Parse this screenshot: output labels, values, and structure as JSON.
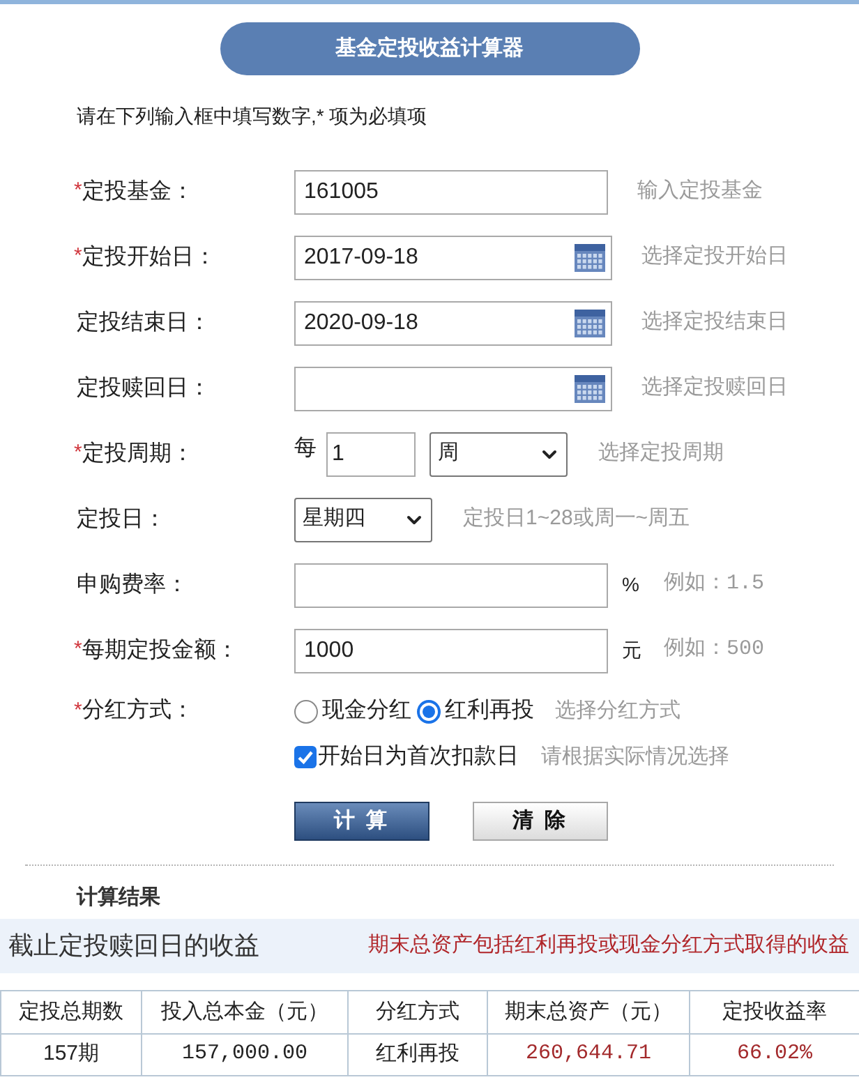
{
  "header": {
    "title": "基金定投收益计算器"
  },
  "instruction": "请在下列输入框中填写数字,* 项为必填项",
  "form": {
    "rows": [
      {
        "kind": "text",
        "mark": "*",
        "label": "定投基金：",
        "value": "161005",
        "hint": "输入定投基金"
      },
      {
        "kind": "date",
        "mark": "*",
        "label": "定投开始日：",
        "value": "2017-09-18",
        "hint": "选择定投开始日"
      },
      {
        "kind": "date",
        "label": "定投结束日：",
        "value": "2020-09-18",
        "hint": "选择定投结束日"
      },
      {
        "kind": "date",
        "label": "定投赎回日：",
        "hint": "选择定投赎回日"
      },
      {
        "kind": "period",
        "mark": "*",
        "label": "定投周期：",
        "prefix": "每",
        "value": "1",
        "unit": "周",
        "hint": "选择定投周期"
      },
      {
        "kind": "select",
        "label": "定投日：",
        "value": "星期四",
        "hint": "定投日1~28或周一~周五"
      },
      {
        "kind": "text",
        "label": "申购费率：",
        "suffix": "%",
        "hint": "例如：1.5"
      },
      {
        "kind": "text",
        "mark": "*",
        "label": "每期定投金额：",
        "value": "1000",
        "suffix": "元",
        "hint": "例如：500"
      },
      {
        "kind": "radio",
        "mark": "*",
        "label": "分红方式：",
        "options": [
          {
            "label": "现金分红",
            "selected": false
          },
          {
            "label": "红利再投",
            "selected": true
          }
        ],
        "hint": "选择分红方式"
      },
      {
        "kind": "checkbox",
        "checked": true,
        "text": "开始日为首次扣款日",
        "hint": "请根据实际情况选择"
      }
    ],
    "buttons": [
      {
        "label": "计 算",
        "primary": true
      },
      {
        "label": "清 除",
        "primary": false
      }
    ]
  },
  "results": {
    "heading": "计算结果",
    "title": "截止定投赎回日的收益",
    "note": "期末总资产包括红利再投或现金分红方式取得的收益",
    "table": {
      "columns": [
        "定投总期数",
        "投入总本金（元）",
        "分红方式",
        "期末总资产（元）",
        "定投收益率"
      ],
      "rows": [
        {
          "cells": [
            {
              "text": "157期",
              "emphasis": false
            },
            {
              "text": "157,000.00",
              "emphasis": false
            },
            {
              "text": "红利再投",
              "emphasis": false
            },
            {
              "text": "260,644.71",
              "emphasis": true
            },
            {
              "text": "66.02%",
              "emphasis": true
            }
          ]
        }
      ]
    }
  }
}
